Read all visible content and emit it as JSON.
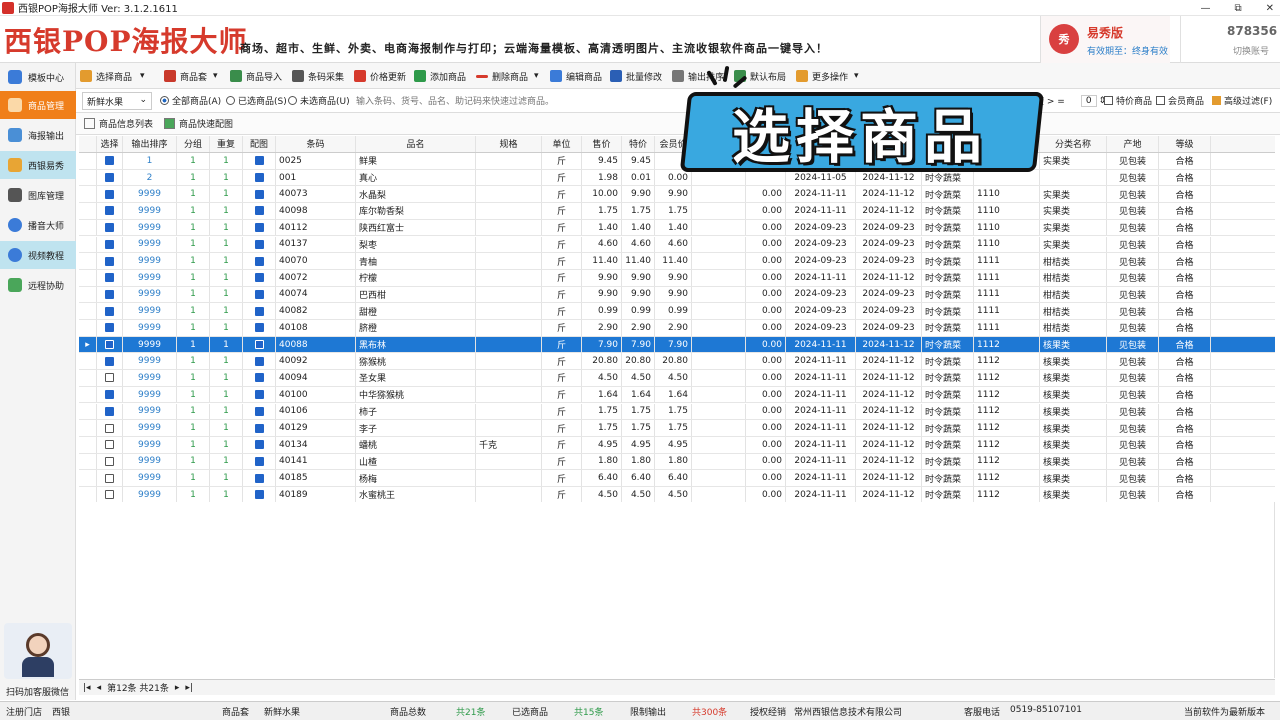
{
  "window": {
    "title": "西银POP海报大师 Ver: 3.1.2.1611",
    "buttons": [
      "—",
      "⧉",
      "✕"
    ]
  },
  "banner": {
    "logo": "西银POP海报大师",
    "slogan": "商场、超市、生鲜、外卖、电商海报制作与打印；云端海量模板、高清透明图片、主流收银软件商品一键导入！",
    "edition_icon": "秀",
    "edition": "易秀版",
    "validity": "有效期至：终身有效",
    "account": "878356",
    "switch_account": "切换账号"
  },
  "sidebar": {
    "items": [
      {
        "label": "模板中心",
        "icon": "chart-icon"
      },
      {
        "label": "商品管理",
        "icon": "tag-icon"
      },
      {
        "label": "海报输出",
        "icon": "poster-icon"
      },
      {
        "label": "西银易秀",
        "icon": "monitor-icon"
      },
      {
        "label": "图库管理",
        "icon": "image-icon"
      },
      {
        "label": "播音大师",
        "icon": "broadcast-icon"
      },
      {
        "label": "视频教程",
        "icon": "help-icon"
      },
      {
        "label": "远程协助",
        "icon": "remote-icon"
      }
    ],
    "scan_label": "扫码加客服微信"
  },
  "toolbar": {
    "items": [
      "选择商品",
      "商品套",
      "商品导入",
      "条码采集",
      "价格更新",
      "添加商品",
      "删除商品",
      "编辑商品",
      "批量修改",
      "输出排序",
      "默认布局",
      "更多操作"
    ]
  },
  "filter": {
    "category": "新鲜水果",
    "radios": [
      "全部商品(A)",
      "已选商品(S)",
      "未选商品(U)"
    ],
    "search_placeholder": "输入条码、货号、品名、助记码来快速过滤商品。",
    "name_length_label": "品名长度 > =",
    "name_length_value": "0",
    "special_label": "特价商品",
    "member_label": "会员商品",
    "advanced_label": "高级过滤(F)"
  },
  "views": {
    "list": "商品信息列表",
    "quick": "商品快速配图"
  },
  "table": {
    "headers": [
      "选择",
      "输出排序",
      "分组",
      "重复",
      "配图",
      "条码",
      "品名",
      "规格",
      "单位",
      "售价",
      "特价",
      "会员价",
      "",
      "",
      "",
      "",
      "",
      "",
      "分类名称",
      "产地",
      "等级"
    ],
    "rows": [
      {
        "sel": true,
        "order": "1",
        "group": "1",
        "dup": "1",
        "img": true,
        "code": "0025",
        "name": "鲜果",
        "spec": "",
        "unit": "斤",
        "price": "9.45",
        "special": "9.45",
        "member": "",
        "v": "",
        "d1": "",
        "d2": "",
        "type": "",
        "cat": "",
        "cname": "实果类",
        "origin": "见包装",
        "grade": "合格"
      },
      {
        "sel": true,
        "order": "2",
        "group": "1",
        "dup": "1",
        "img": true,
        "code": "001",
        "name": "真心",
        "spec": "",
        "unit": "斤",
        "price": "1.98",
        "special": "0.01",
        "member": "0.00",
        "v": "",
        "d1": "2024-11-05",
        "d2": "2024-11-12",
        "type": "时令蔬菜",
        "cat": "",
        "cname": "",
        "origin": "见包装",
        "grade": "合格"
      },
      {
        "sel": true,
        "order": "9999",
        "group": "1",
        "dup": "1",
        "img": true,
        "code": "40073",
        "name": "水晶梨",
        "spec": "",
        "unit": "斤",
        "price": "10.00",
        "special": "9.90",
        "member": "9.90",
        "v": "0.00",
        "d1": "2024-11-11",
        "d2": "2024-11-12",
        "type": "时令蔬菜",
        "cat": "1110",
        "cname": "实果类",
        "origin": "见包装",
        "grade": "合格"
      },
      {
        "sel": true,
        "order": "9999",
        "group": "1",
        "dup": "1",
        "img": true,
        "code": "40098",
        "name": "库尔勒香梨",
        "spec": "",
        "unit": "斤",
        "price": "1.75",
        "special": "1.75",
        "member": "1.75",
        "v": "0.00",
        "d1": "2024-11-11",
        "d2": "2024-11-12",
        "type": "时令蔬菜",
        "cat": "1110",
        "cname": "实果类",
        "origin": "见包装",
        "grade": "合格"
      },
      {
        "sel": true,
        "order": "9999",
        "group": "1",
        "dup": "1",
        "img": true,
        "code": "40112",
        "name": "陕西红富士",
        "spec": "",
        "unit": "斤",
        "price": "1.40",
        "special": "1.40",
        "member": "1.40",
        "v": "0.00",
        "d1": "2024-09-23",
        "d2": "2024-09-23",
        "type": "时令蔬菜",
        "cat": "1110",
        "cname": "实果类",
        "origin": "见包装",
        "grade": "合格"
      },
      {
        "sel": true,
        "order": "9999",
        "group": "1",
        "dup": "1",
        "img": true,
        "code": "40137",
        "name": "梨枣",
        "spec": "",
        "unit": "斤",
        "price": "4.60",
        "special": "4.60",
        "member": "4.60",
        "v": "0.00",
        "d1": "2024-09-23",
        "d2": "2024-09-23",
        "type": "时令蔬菜",
        "cat": "1110",
        "cname": "实果类",
        "origin": "见包装",
        "grade": "合格"
      },
      {
        "sel": true,
        "order": "9999",
        "group": "1",
        "dup": "1",
        "img": true,
        "code": "40070",
        "name": "青柚",
        "spec": "",
        "unit": "斤",
        "price": "11.40",
        "special": "11.40",
        "member": "11.40",
        "v": "0.00",
        "d1": "2024-09-23",
        "d2": "2024-09-23",
        "type": "时令蔬菜",
        "cat": "1111",
        "cname": "柑桔类",
        "origin": "见包装",
        "grade": "合格"
      },
      {
        "sel": true,
        "order": "9999",
        "group": "1",
        "dup": "1",
        "img": true,
        "code": "40072",
        "name": "柠檬",
        "spec": "",
        "unit": "斤",
        "price": "9.90",
        "special": "9.90",
        "member": "9.90",
        "v": "0.00",
        "d1": "2024-11-11",
        "d2": "2024-11-12",
        "type": "时令蔬菜",
        "cat": "1111",
        "cname": "柑桔类",
        "origin": "见包装",
        "grade": "合格"
      },
      {
        "sel": true,
        "order": "9999",
        "group": "1",
        "dup": "1",
        "img": true,
        "code": "40074",
        "name": "巴西柑",
        "spec": "",
        "unit": "斤",
        "price": "9.90",
        "special": "9.90",
        "member": "9.90",
        "v": "0.00",
        "d1": "2024-09-23",
        "d2": "2024-09-23",
        "type": "时令蔬菜",
        "cat": "1111",
        "cname": "柑桔类",
        "origin": "见包装",
        "grade": "合格"
      },
      {
        "sel": true,
        "order": "9999",
        "group": "1",
        "dup": "1",
        "img": true,
        "code": "40082",
        "name": "甜橙",
        "spec": "",
        "unit": "斤",
        "price": "0.99",
        "special": "0.99",
        "member": "0.99",
        "v": "0.00",
        "d1": "2024-09-23",
        "d2": "2024-09-23",
        "type": "时令蔬菜",
        "cat": "1111",
        "cname": "柑桔类",
        "origin": "见包装",
        "grade": "合格"
      },
      {
        "sel": true,
        "order": "9999",
        "group": "1",
        "dup": "1",
        "img": true,
        "code": "40108",
        "name": "脐橙",
        "spec": "",
        "unit": "斤",
        "price": "2.90",
        "special": "2.90",
        "member": "2.90",
        "v": "0.00",
        "d1": "2024-09-23",
        "d2": "2024-09-23",
        "type": "时令蔬菜",
        "cat": "1111",
        "cname": "柑桔类",
        "origin": "见包装",
        "grade": "合格"
      },
      {
        "sel": true,
        "order": "9999",
        "group": "1",
        "dup": "1",
        "img": true,
        "code": "40088",
        "name": "黑布林",
        "spec": "",
        "unit": "斤",
        "price": "7.90",
        "special": "7.90",
        "member": "7.90",
        "v": "0.00",
        "d1": "2024-11-11",
        "d2": "2024-11-12",
        "type": "时令蔬菜",
        "cat": "1112",
        "cname": "核果类",
        "origin": "见包装",
        "grade": "合格",
        "selected": true
      },
      {
        "sel": true,
        "order": "9999",
        "group": "1",
        "dup": "1",
        "img": true,
        "code": "40092",
        "name": "猕猴桃",
        "spec": "",
        "unit": "斤",
        "price": "20.80",
        "special": "20.80",
        "member": "20.80",
        "v": "0.00",
        "d1": "2024-11-11",
        "d2": "2024-11-12",
        "type": "时令蔬菜",
        "cat": "1112",
        "cname": "核果类",
        "origin": "见包装",
        "grade": "合格"
      },
      {
        "sel": false,
        "order": "9999",
        "group": "1",
        "dup": "1",
        "img": true,
        "code": "40094",
        "name": "圣女果",
        "spec": "",
        "unit": "斤",
        "price": "4.50",
        "special": "4.50",
        "member": "4.50",
        "v": "0.00",
        "d1": "2024-11-11",
        "d2": "2024-11-12",
        "type": "时令蔬菜",
        "cat": "1112",
        "cname": "核果类",
        "origin": "见包装",
        "grade": "合格"
      },
      {
        "sel": true,
        "order": "9999",
        "group": "1",
        "dup": "1",
        "img": true,
        "code": "40100",
        "name": "中华猕猴桃",
        "spec": "",
        "unit": "斤",
        "price": "1.64",
        "special": "1.64",
        "member": "1.64",
        "v": "0.00",
        "d1": "2024-11-11",
        "d2": "2024-11-12",
        "type": "时令蔬菜",
        "cat": "1112",
        "cname": "核果类",
        "origin": "见包装",
        "grade": "合格"
      },
      {
        "sel": true,
        "order": "9999",
        "group": "1",
        "dup": "1",
        "img": true,
        "code": "40106",
        "name": "柿子",
        "spec": "",
        "unit": "斤",
        "price": "1.75",
        "special": "1.75",
        "member": "1.75",
        "v": "0.00",
        "d1": "2024-11-11",
        "d2": "2024-11-12",
        "type": "时令蔬菜",
        "cat": "1112",
        "cname": "核果类",
        "origin": "见包装",
        "grade": "合格"
      },
      {
        "sel": false,
        "order": "9999",
        "group": "1",
        "dup": "1",
        "img": true,
        "code": "40129",
        "name": "李子",
        "spec": "",
        "unit": "斤",
        "price": "1.75",
        "special": "1.75",
        "member": "1.75",
        "v": "0.00",
        "d1": "2024-11-11",
        "d2": "2024-11-12",
        "type": "时令蔬菜",
        "cat": "1112",
        "cname": "核果类",
        "origin": "见包装",
        "grade": "合格"
      },
      {
        "sel": false,
        "order": "9999",
        "group": "1",
        "dup": "1",
        "img": true,
        "code": "40134",
        "name": "蟠桃",
        "spec": "千克",
        "unit": "斤",
        "price": "4.95",
        "special": "4.95",
        "member": "4.95",
        "v": "0.00",
        "d1": "2024-11-11",
        "d2": "2024-11-12",
        "type": "时令蔬菜",
        "cat": "1112",
        "cname": "核果类",
        "origin": "见包装",
        "grade": "合格"
      },
      {
        "sel": false,
        "order": "9999",
        "group": "1",
        "dup": "1",
        "img": true,
        "code": "40141",
        "name": "山楂",
        "spec": "",
        "unit": "斤",
        "price": "1.80",
        "special": "1.80",
        "member": "1.80",
        "v": "0.00",
        "d1": "2024-11-11",
        "d2": "2024-11-12",
        "type": "时令蔬菜",
        "cat": "1112",
        "cname": "核果类",
        "origin": "见包装",
        "grade": "合格"
      },
      {
        "sel": false,
        "order": "9999",
        "group": "1",
        "dup": "1",
        "img": true,
        "code": "40185",
        "name": "杨梅",
        "spec": "",
        "unit": "斤",
        "price": "6.40",
        "special": "6.40",
        "member": "6.40",
        "v": "0.00",
        "d1": "2024-11-11",
        "d2": "2024-11-12",
        "type": "时令蔬菜",
        "cat": "1112",
        "cname": "核果类",
        "origin": "见包装",
        "grade": "合格"
      },
      {
        "sel": false,
        "order": "9999",
        "group": "1",
        "dup": "1",
        "img": true,
        "code": "40189",
        "name": "水蜜桃王",
        "spec": "",
        "unit": "斤",
        "price": "4.50",
        "special": "4.50",
        "member": "4.50",
        "v": "0.00",
        "d1": "2024-11-11",
        "d2": "2024-11-12",
        "type": "时令蔬菜",
        "cat": "1112",
        "cname": "核果类",
        "origin": "见包装",
        "grade": "合格"
      }
    ]
  },
  "pager": {
    "text": "第12条 共21条"
  },
  "status": {
    "store_label": "注册门店",
    "store": "西银",
    "set_label": "商品套",
    "set": "新鲜水果",
    "total_label": "商品总数",
    "total": "共21条",
    "selected_label": "已选商品",
    "selected": "共15条",
    "limit_label": "限制输出",
    "limit": "共300条",
    "dealer_label": "授权经销",
    "dealer": "常州西银信息技术有限公司",
    "phone_label": "客服电话",
    "phone": "0519-85107101",
    "version": "当前软件为最新版本"
  },
  "overlay": {
    "text": "选择商品"
  },
  "colors": {
    "accent": "#f07f1a",
    "selection": "#1e78d4",
    "brand": "#d63a2c",
    "overlay": "#39a8e0"
  }
}
